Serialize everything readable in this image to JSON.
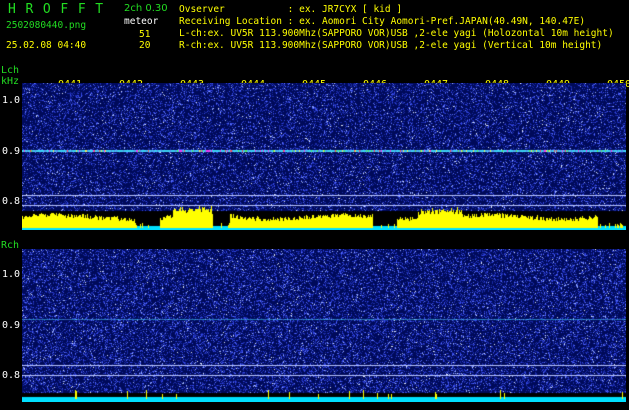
{
  "header": {
    "app_title": "H R O F F T",
    "mode": "2ch 0.30",
    "filename": "2502080440.png",
    "meteor_label": "meteor",
    "meteor_counts": [
      "51",
      "20"
    ],
    "datetime": "25.02.08 04:40",
    "observer_line": "Ovserver           : ex. JR7CYX [ kid ]",
    "location_line": "Receiving Location : ex. Aomori City Aomori-Pref.JAPAN(40.49N, 140.47E)",
    "lch_line": "L-ch:ex. UV5R 113.900Mhz(SAPPORO VOR)USB ,2-ele yagi (Holozontal 10m height)",
    "rch_line": "R-ch:ex. UV5R 113.900Mhz(SAPPORO VOR)USB ,2-ele yagi (Vertical 10m height)"
  },
  "time_ticks": [
    "0441",
    "0442",
    "0443",
    "0444",
    "0445",
    "0446",
    "0447",
    "0448",
    "0449",
    "0450"
  ],
  "lch_panel": {
    "channel_label": "Lch",
    "unit_label": "kHz",
    "y_labels": [
      "1.0",
      "0.9",
      "0.8"
    ],
    "trace_frequency_khz": 0.9,
    "reference_lines_khz": [
      0.81,
      0.79
    ]
  },
  "rch_panel": {
    "channel_label": "Rch",
    "y_labels": [
      "1.0",
      "0.9",
      "0.8"
    ],
    "trace_frequency_khz": 0.9,
    "reference_lines_khz": [
      0.81,
      0.79
    ]
  },
  "colors": {
    "background": "#000000",
    "spectrogram_base": "#000a5a",
    "noise_blue": "#2a3cff",
    "carrier_cyan": "#40e0ff",
    "level_yellow": "#ffff00",
    "level_cyan": "#00e0ff",
    "axis_green": "#22dd22",
    "tick_yellow": "#ffff00"
  }
}
